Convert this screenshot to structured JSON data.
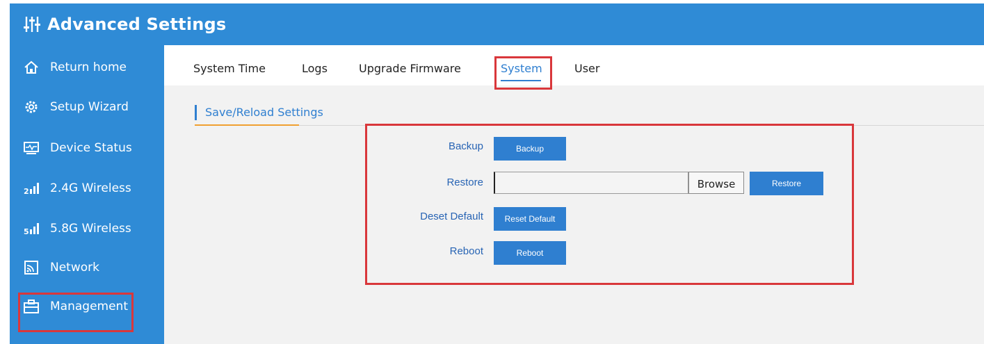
{
  "header": {
    "title": "Advanced Settings",
    "icon": "sliders-icon"
  },
  "sidebar": {
    "items": [
      {
        "label": "Return home",
        "icon": "home-icon"
      },
      {
        "label": "Setup Wizard",
        "icon": "gear-icon"
      },
      {
        "label": "Device Status",
        "icon": "monitor-icon"
      },
      {
        "label": "2.4G Wireless",
        "icon": "signal-2g-icon"
      },
      {
        "label": "5.8G Wireless",
        "icon": "signal-5g-icon"
      },
      {
        "label": "Network",
        "icon": "network-icon"
      },
      {
        "label": "Management",
        "icon": "toolbox-icon"
      }
    ]
  },
  "tabs": [
    {
      "label": "System Time"
    },
    {
      "label": "Logs"
    },
    {
      "label": "Upgrade Firmware"
    },
    {
      "label": "System",
      "active": true
    },
    {
      "label": "User"
    }
  ],
  "section": {
    "title": "Save/Reload Settings"
  },
  "form": {
    "backup": {
      "label": "Backup",
      "button": "Backup"
    },
    "restore": {
      "label": "Restore",
      "browse": "Browse",
      "button": "Restore",
      "file_value": ""
    },
    "reset": {
      "label": "Deset Default",
      "button": "Reset Default"
    },
    "reboot": {
      "label": "Reboot",
      "button": "Reboot"
    }
  },
  "colors": {
    "primary": "#2f8bd6",
    "accent": "#2f7fd0",
    "highlight": "#d9373b",
    "background": "#f2f2f2"
  }
}
